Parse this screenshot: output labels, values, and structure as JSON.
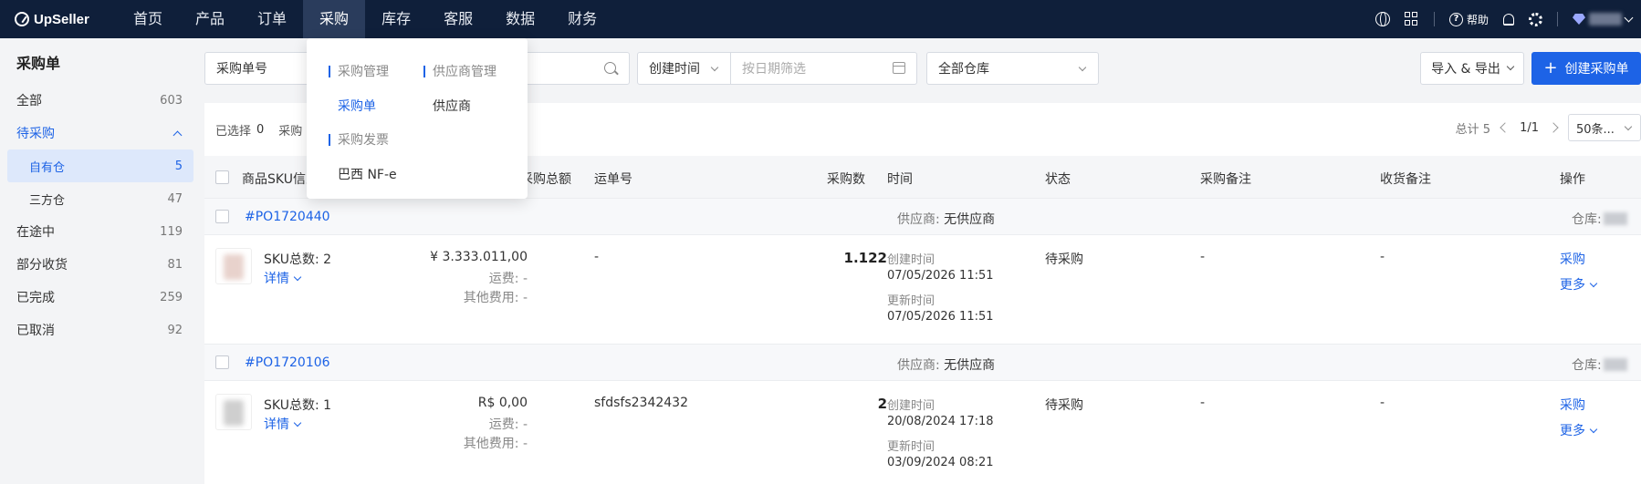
{
  "topnav": {
    "logo": "UpSeller",
    "items": [
      "首页",
      "产品",
      "订单",
      "采购",
      "库存",
      "客服",
      "数据",
      "财务"
    ],
    "active": "采购",
    "help_label": "帮助"
  },
  "sidebar": {
    "title": "采购单",
    "items": [
      {
        "label": "全部",
        "count": "603"
      },
      {
        "label": "待采购",
        "count": ""
      },
      {
        "label": "自有仓",
        "count": "5"
      },
      {
        "label": "三方仓",
        "count": "47"
      },
      {
        "label": "在途中",
        "count": "119"
      },
      {
        "label": "部分收货",
        "count": "81"
      },
      {
        "label": "已完成",
        "count": "259"
      },
      {
        "label": "已取消",
        "count": "92"
      }
    ]
  },
  "filters": {
    "search_field": "采购单号",
    "date_type": "创建时间",
    "date_placeholder": "按日期筛选",
    "warehouse": "全部仓库",
    "import_export": "导入 & 导出",
    "create_button": "创建采购单"
  },
  "toolbar": {
    "selected_label": "已选择",
    "selected_count": "0",
    "bulk_action": "采购",
    "total": "总计 5",
    "page": "1/1",
    "page_size": "50条..."
  },
  "table": {
    "headers": {
      "sku": "商品SKU信息",
      "amount": "采购总额",
      "tracking": "运单号",
      "qty": "采购数",
      "time": "时间",
      "status": "状态",
      "purchase_note": "采购备注",
      "receipt_note": "收货备注",
      "actions": "操作"
    },
    "groups": [
      {
        "po": "#PO1720440",
        "supplier_label": "供应商:",
        "supplier": "无供应商",
        "warehouse_label": "仓库:",
        "sku_total": "SKU总数: 2",
        "detail": "详情",
        "amount": "¥ 3.333.011,00",
        "freight": "运费: -",
        "other": "其他费用: -",
        "tracking": "-",
        "qty": "1.122",
        "created_label": "创建时间",
        "created": "07/05/2026 11:51",
        "updated_label": "更新时间",
        "updated": "07/05/2026 11:51",
        "status": "待采购",
        "purchase_note": "-",
        "receipt_note": "-",
        "action_primary": "采购",
        "action_more": "更多"
      },
      {
        "po": "#PO1720106",
        "supplier_label": "供应商:",
        "supplier": "无供应商",
        "warehouse_label": "仓库:",
        "sku_total": "SKU总数: 1",
        "detail": "详情",
        "amount": "R$ 0,00",
        "freight": "运费: -",
        "other": "其他费用: -",
        "tracking": "sfdsfs2342432",
        "qty": "2",
        "created_label": "创建时间",
        "created": "20/08/2024 17:18",
        "updated_label": "更新时间",
        "updated": "03/09/2024 08:21",
        "status": "待采购",
        "purchase_note": "-",
        "receipt_note": "-",
        "action_primary": "采购",
        "action_more": "更多"
      }
    ]
  },
  "dropdown": {
    "section1": "采购管理",
    "section2": "供应商管理",
    "link1": "采购单",
    "link2": "供应商",
    "section3": "采购发票",
    "link3": "巴西 NF-e"
  },
  "colors": {
    "nav_bg": "#0f1f3a",
    "accent": "#1d63e6"
  }
}
